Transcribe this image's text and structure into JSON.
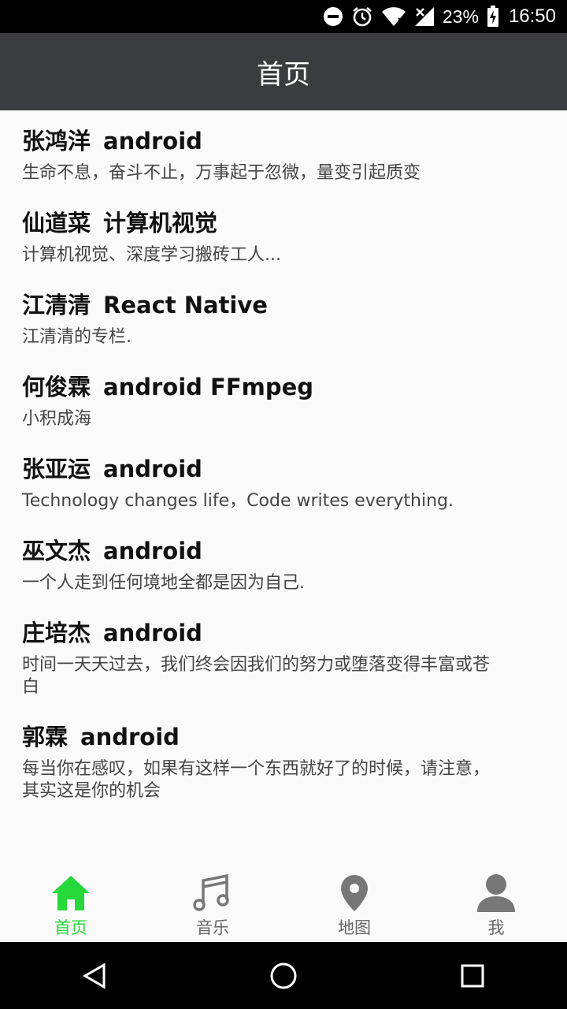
{
  "status_bar": {
    "battery_percent": "23%",
    "time": "16:50",
    "icons": [
      "do-not-disturb-icon",
      "alarm-icon",
      "wifi-icon",
      "signal-icon",
      "battery-charging-icon"
    ]
  },
  "app_bar": {
    "title": "首页"
  },
  "list": {
    "items": [
      {
        "name": "张鸿洋",
        "tags": "android",
        "desc": "生命不息，奋斗不止，万事起于忽微，量变引起质变"
      },
      {
        "name": "仙道菜",
        "tags": "计算机视觉",
        "desc": "计算机视觉、深度学习搬砖工人..."
      },
      {
        "name": "江清清",
        "tags": "React Native",
        "desc": "江清清的专栏."
      },
      {
        "name": "何俊霖",
        "tags": "android FFmpeg",
        "desc": "小积成海"
      },
      {
        "name": "张亚运",
        "tags": "android",
        "desc": "Technology changes life，Code writes everything."
      },
      {
        "name": "巫文杰",
        "tags": "android",
        "desc": "一个人走到任何境地全都是因为自己."
      },
      {
        "name": "庄培杰",
        "tags": "android",
        "desc": "时间一天天过去，我们终会因我们的努力或堕落变得丰富或苍白"
      },
      {
        "name": "郭霖",
        "tags": "android",
        "desc": "每当你在感叹，如果有这样一个东西就好了的时候，请注意，其实这是你的机会"
      }
    ]
  },
  "tabbar": {
    "active_color": "#27d83b",
    "inactive_color": "#666666",
    "tabs": [
      {
        "label": "首页",
        "icon": "home-icon",
        "active": true
      },
      {
        "label": "音乐",
        "icon": "music-note-icon",
        "active": false
      },
      {
        "label": "地图",
        "icon": "map-pin-icon",
        "active": false
      },
      {
        "label": "我",
        "icon": "person-icon",
        "active": false
      }
    ]
  },
  "navbar": {
    "icons": [
      "back-icon",
      "home-circle-icon",
      "recents-icon"
    ]
  }
}
